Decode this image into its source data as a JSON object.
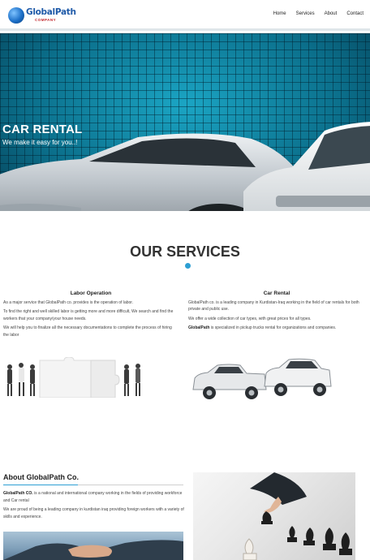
{
  "header": {
    "logo_text": "GlobalPath",
    "logo_sub": "COMPANY",
    "nav": [
      {
        "label": "Home"
      },
      {
        "label": "Services"
      },
      {
        "label": "About"
      },
      {
        "label": "Contact"
      }
    ]
  },
  "hero": {
    "title": "CAR RENTAL",
    "subtitle": "We make it easy for you..!"
  },
  "services": {
    "title": "OUR SERVICES",
    "accent_color": "#2d9fd3",
    "left": {
      "title": "Labor Operation",
      "paragraphs": [
        "As a major service that GlobalPath co. provides is the operation of labor.",
        "To find the right and well skilled labor is getting more and more difficult, We search and find the workers that your company/your house needs.",
        "We will help you to finalize all the necessary documentations to complete the process of hiring the labor"
      ]
    },
    "right": {
      "title": "Car Rental",
      "paragraphs": [
        "GlobalPath co. is a leading company in Kurdistan-Iraq working in the field of car rentals for both private and public use.",
        "We offer a wide collection of car types, with great prices for all types."
      ],
      "highlight_strong": "GlobalPath",
      "highlight_rest": " is specialized in pickup trucks rental for organizations and companies."
    }
  },
  "about": {
    "title": "About GlobalPath Co.",
    "p1_strong": "GlobalPath CO.",
    "p1_rest": " is a national and international company working in the fields of providing workforce and Car rental",
    "p2": "We are proud of being a leading company in kurdistan iraq providing foreign workers with a variety of skills and experience."
  },
  "colors": {
    "hero_bg": "#0a7390",
    "brand_blue": "#1f5aa8",
    "brand_red": "#c2262c"
  }
}
